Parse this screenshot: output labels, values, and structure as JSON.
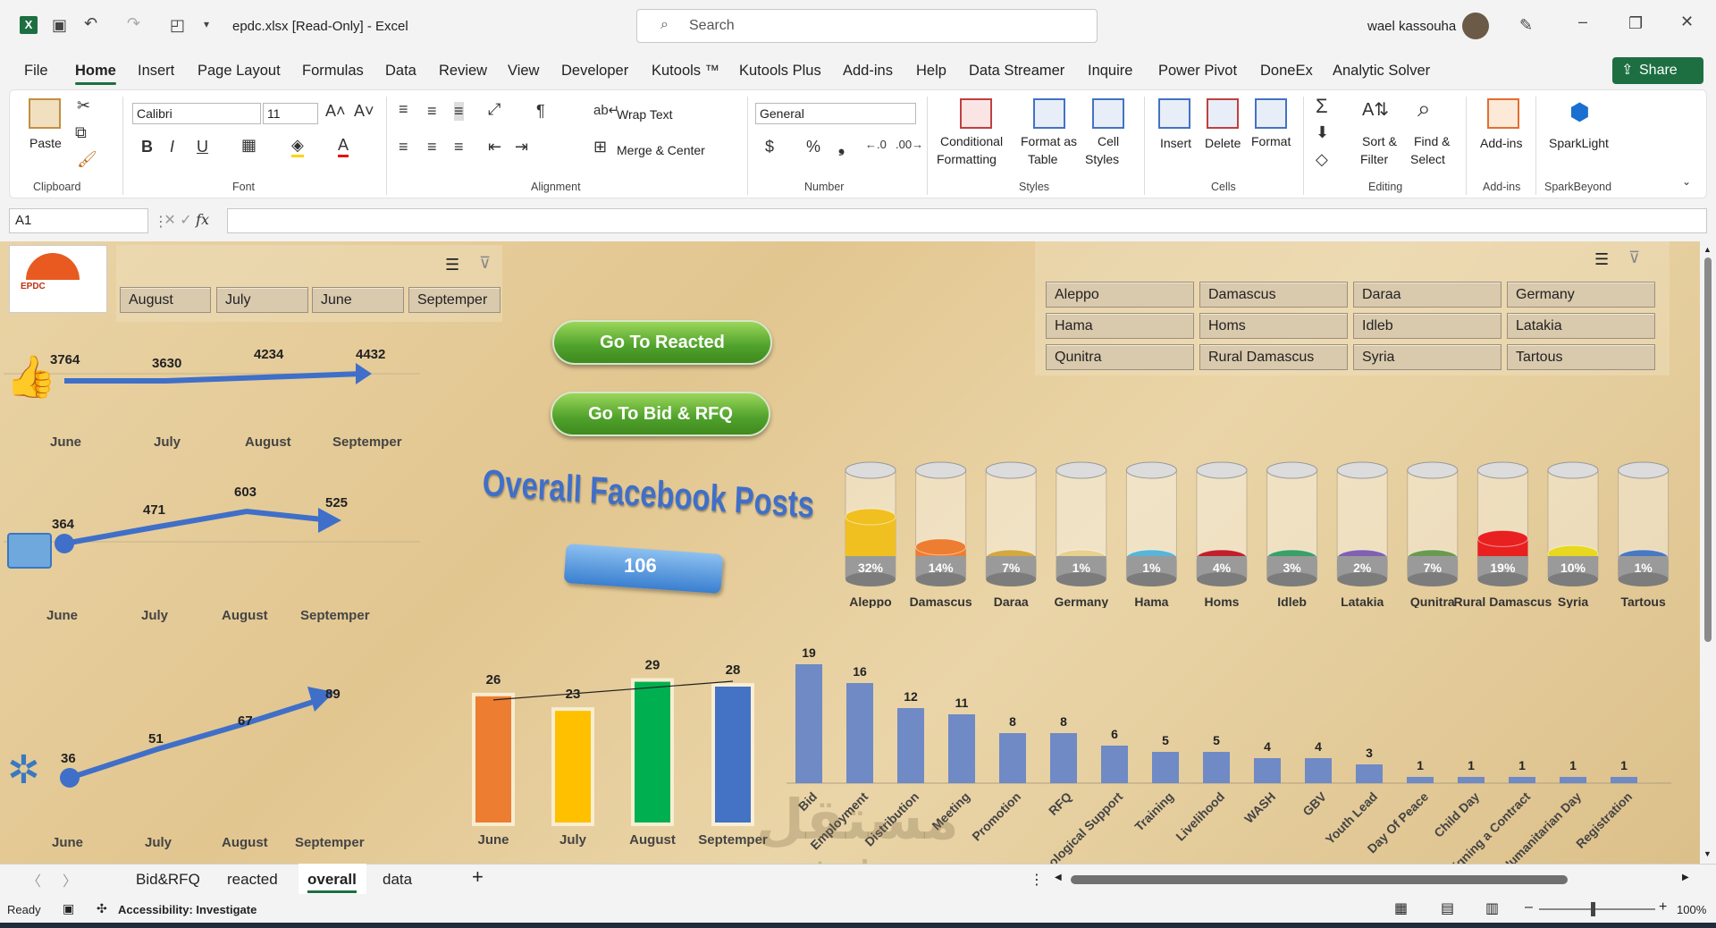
{
  "titlebar": {
    "filename": "epdc.xlsx  [Read-Only]  -  Excel",
    "search_placeholder": "Search",
    "user": "wael kassouha"
  },
  "menu": [
    "File",
    "Home",
    "Insert",
    "Page Layout",
    "Formulas",
    "Data",
    "Review",
    "View",
    "Developer",
    "Kutools ™",
    "Kutools Plus",
    "Add-ins",
    "Help",
    "Data Streamer",
    "Inquire",
    "Power Pivot",
    "DoneEx",
    "Analytic Solver"
  ],
  "share_label": "Share",
  "ribbon": {
    "paste": "Paste",
    "clipboard": "Clipboard",
    "font_name": "Calibri",
    "font_size": "11",
    "font": "Font",
    "wrap": "Wrap Text",
    "merge": "Merge & Center",
    "alignment": "Alignment",
    "numfmt": "General",
    "number": "Number",
    "cond1": "Conditional",
    "cond2": "Formatting",
    "fat1": "Format as",
    "fat2": "Table",
    "cs1": "Cell",
    "cs2": "Styles",
    "styles": "Styles",
    "insert": "Insert",
    "delete": "Delete",
    "format": "Format",
    "cells": "Cells",
    "sort1": "Sort &",
    "sort2": "Filter",
    "find1": "Find &",
    "find2": "Select",
    "editing": "Editing",
    "addins": "Add-ins",
    "addins_group": "Add-ins",
    "spark": "SparkLight",
    "sparkgroup": "SparkBeyond"
  },
  "formula": {
    "namebox": "A1",
    "fx": "fx"
  },
  "sheet": {
    "month_slicer": [
      "August",
      "July",
      "June",
      "Septemper"
    ],
    "city_slicer": [
      "Aleppo",
      "Damascus",
      "Daraa",
      "Germany",
      "Hama",
      "Homs",
      "Idleb",
      "Latakia",
      "Qunitra",
      "Rural Damascus",
      "Syria",
      "Tartous"
    ],
    "btn_reacted": "Go To Reacted",
    "btn_bid": "Go To Bid & RFQ",
    "title": "Overall Facebook Posts",
    "total": "106",
    "likes": {
      "values": [
        "3764",
        "3630",
        "4234",
        "4432"
      ],
      "months": [
        "June",
        "July",
        "August",
        "Septemper"
      ]
    },
    "comments": {
      "values": [
        "364",
        "471",
        "603",
        "525"
      ],
      "months": [
        "June",
        "July",
        "August",
        "Septemper"
      ]
    },
    "shares": {
      "values": [
        "36",
        "51",
        "67",
        "89"
      ],
      "months": [
        "June",
        "July",
        "August",
        "Septemper"
      ]
    }
  },
  "chart_data": [
    {
      "type": "bar",
      "categories": [
        "June",
        "July",
        "August",
        "Septemper"
      ],
      "values": [
        26,
        23,
        29,
        28
      ],
      "colors": [
        "#ed7d31",
        "#ffc000",
        "#00b050",
        "#4472c4"
      ],
      "trendline": true
    },
    {
      "type": "bar",
      "categories": [
        "Aleppo",
        "Damascus",
        "Daraa",
        "Germany",
        "Hama",
        "Homs",
        "Idleb",
        "Latakia",
        "Qunitra",
        "Rural Damascus",
        "Syria",
        "Tartous"
      ],
      "values": [
        32,
        14,
        7,
        1,
        1,
        4,
        3,
        2,
        7,
        19,
        10,
        1
      ],
      "labels": [
        "32%",
        "14%",
        "7%",
        "1%",
        "1%",
        "4%",
        "3%",
        "2%",
        "7%",
        "19%",
        "10%",
        "1%"
      ],
      "colors": [
        "#f0c020",
        "#ed7d31",
        "#d4a840",
        "#e8d090",
        "#5ab4d8",
        "#c0202a",
        "#3aa068",
        "#8060b0",
        "#6a9a50",
        "#e82020",
        "#e8d820",
        "#4a78c0"
      ]
    },
    {
      "type": "bar",
      "categories": [
        "Bid",
        "Employment",
        "Distribution",
        "Meeting",
        "Promotion",
        "RFQ",
        "Psychological Support",
        "Training",
        "Livelihood",
        "WASH",
        "GBV",
        "Youth Lead",
        "Day Of Peace",
        "Child Day",
        "Signing a Contract",
        "Humanitarian Day",
        "Registration"
      ],
      "values": [
        19,
        16,
        12,
        11,
        8,
        8,
        6,
        5,
        5,
        4,
        4,
        3,
        1,
        1,
        1,
        1,
        1
      ],
      "color": "#6f8ac4",
      "ylim": [
        0,
        20
      ]
    }
  ],
  "tabs": [
    "Bid&RFQ",
    "reacted",
    "overall",
    "data"
  ],
  "status": {
    "ready": "Ready",
    "access": "Accessibility: Investigate",
    "zoom": "100%"
  },
  "watermark": {
    "ar": "مستقل",
    "en": "mostaql.com"
  }
}
